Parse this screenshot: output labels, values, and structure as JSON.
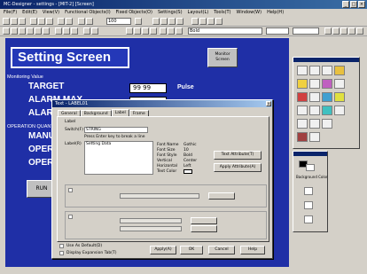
{
  "window": {
    "title": "MC-Designer - settings - [MIT-2] [Screen]"
  },
  "menu": [
    "File(F)",
    "Edit(E)",
    "View(V)",
    "Functional Objects(I)",
    "Fixed Objects(O)",
    "Settings(S)",
    "Layout(L)",
    "Tools(T)",
    "Window(W)",
    "Help(H)"
  ],
  "toolbar": {
    "zoom_value": "100",
    "font_value": "Bold"
  },
  "canvas": {
    "title": "Setting Screen",
    "monitor_button": "Monitor Screen",
    "monitoring_label": "Monitoring Value",
    "target_label": "TARGET",
    "target_value": "99 99",
    "target_unit": "Pulse",
    "alarm1_label": "ALARM MAX",
    "alarm2_label": "ALARM",
    "operation_label": "OPERATION QUANTITY",
    "manual_label": "MANUAL",
    "oper1_label": "OPER",
    "oper2_label": "OPER",
    "run_button": "RUN"
  },
  "dialog": {
    "title": "Text - LABEL01",
    "close": "x",
    "tabs": [
      "General",
      "Background",
      "Label",
      "Frame"
    ],
    "label_group": "Label",
    "switch_label": "Switch(F)",
    "switch_value": "STRING",
    "hint": "Press Enter key to break a line",
    "text_label": "Label(R)",
    "text_value": "Setting Data",
    "font_name_label": "Font Name",
    "font_name_value": "Gothic",
    "font_size_label": "Font Size",
    "font_size_value": "10",
    "font_style_label": "Font Style",
    "font_style_value": "Bold",
    "vertical_label": "Vertical",
    "vertical_value": "Center",
    "horizontal_label": "Horizontal",
    "horizontal_value": "Left",
    "text_color_label": "Text Color",
    "text_attr_button": "Text Attribute(T)",
    "apply_attr_button": "Apply Attribute(A)",
    "use_default_label": "Use As Default(D)",
    "display_tab_label": "Display Expansion Tab(T)",
    "apply_button": "Apply(A)",
    "ok_button": "OK",
    "cancel_button": "Cancel",
    "help_button": "Help"
  },
  "colors": {
    "canvas_bg": "#1f2fa6",
    "title_bar": "#0a246a",
    "window_bg": "#d4d0c8"
  },
  "palette2": {
    "label": "Background Color"
  }
}
